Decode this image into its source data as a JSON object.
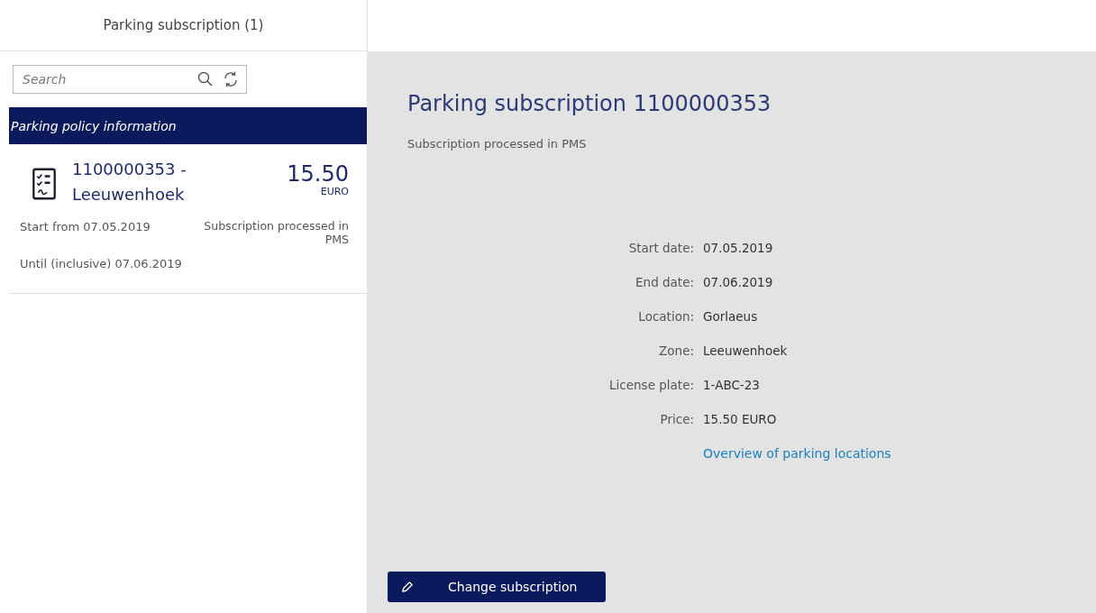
{
  "list_panel": {
    "title": "Parking subscription (1)",
    "search": {
      "placeholder": "Search"
    },
    "group_header": "Parking policy information",
    "items": [
      {
        "number": "1100000353 -",
        "name": "Leeuwenhoek",
        "amount": "15.50",
        "currency": "EURO",
        "start": "Start from 07.05.2019",
        "status": "Subscription processed in PMS",
        "until": "Until (inclusive) 07.06.2019",
        "selected": false
      }
    ]
  },
  "detail": {
    "title": "Parking subscription 1100000353",
    "status": "Subscription processed in PMS",
    "fields": [
      {
        "label": "Start date:",
        "value": "07.05.2019"
      },
      {
        "label": "End date:",
        "value": "07.06.2019"
      },
      {
        "label": "Location:",
        "value": "Gorlaeus"
      },
      {
        "label": "Zone:",
        "value": "Leeuwenhoek"
      },
      {
        "label": "License plate:",
        "value": "1-ABC-23"
      },
      {
        "label": "Price:",
        "value": "15.50 EURO"
      }
    ],
    "link": "Overview of parking locations",
    "button": "Change subscription"
  }
}
